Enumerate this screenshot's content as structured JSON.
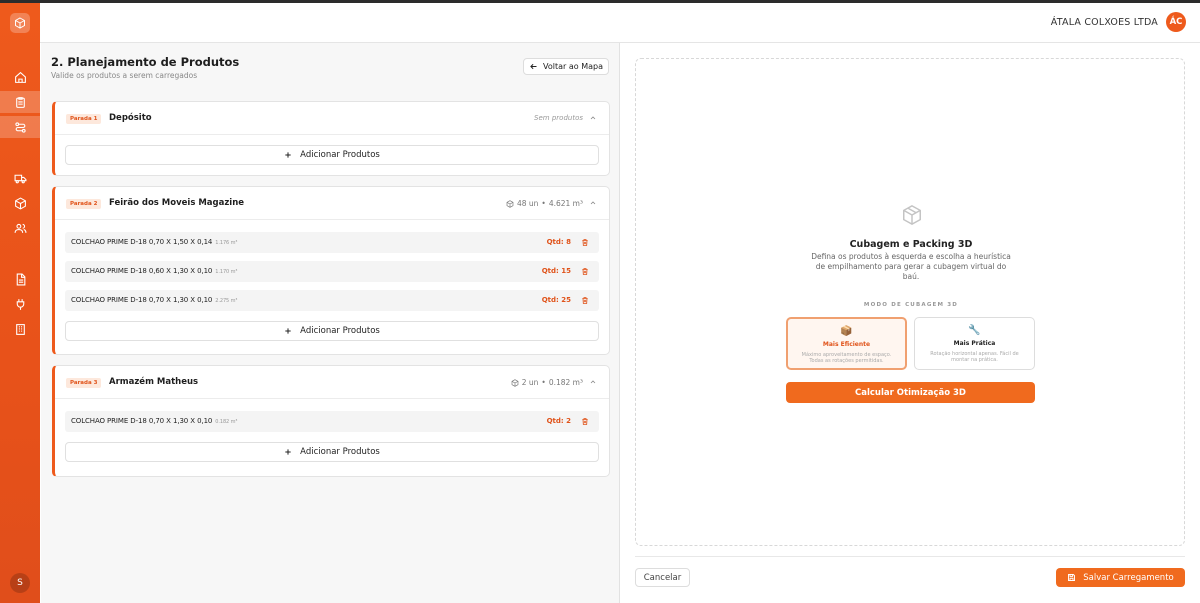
{
  "header": {
    "company": "ÁTALA COLXOES LTDA",
    "avatar_initials": "ÁC"
  },
  "sidebar": {
    "items": [
      {
        "icon": "home-icon"
      },
      {
        "icon": "clipboard-icon",
        "active": true
      },
      {
        "icon": "route-icon",
        "active": true
      },
      {
        "icon": "truck-icon"
      },
      {
        "icon": "box-icon"
      },
      {
        "icon": "users-icon"
      },
      {
        "icon": "document-icon"
      },
      {
        "icon": "plug-icon"
      },
      {
        "icon": "building-icon"
      }
    ],
    "user_initial": "S"
  },
  "planning": {
    "title": "2. Planejamento de Produtos",
    "subtitle": "Valide os produtos a serem carregados",
    "back_label": "Voltar ao Mapa",
    "add_label": "Adicionar Produtos",
    "stops": [
      {
        "badge": "Parada 1",
        "name": "Depósito",
        "meta": "Sem produtos",
        "products": []
      },
      {
        "badge": "Parada 2",
        "name": "Feirão dos Moveis Magazine",
        "units": "48 un",
        "volume": "4.621 m³",
        "products": [
          {
            "name": "COLCHAO PRIME D-18 0,70 X 1,50 X 0,14",
            "vol": "1.176 m³",
            "qty": "Qtd: 8"
          },
          {
            "name": "COLCHAO PRIME D-18 0,60 X 1,30 X 0,10",
            "vol": "1.170 m³",
            "qty": "Qtd: 15"
          },
          {
            "name": "COLCHAO PRIME D-18 0,70 X 1,30 X 0,10",
            "vol": "2.275 m³",
            "qty": "Qtd: 25"
          }
        ]
      },
      {
        "badge": "Parada 3",
        "name": "Armazém Matheus",
        "units": "2 un",
        "volume": "0.182 m³",
        "products": [
          {
            "name": "COLCHAO PRIME D-18 0,70 X 1,30 X 0,10",
            "vol": "0.182 m³",
            "qty": "Qtd: 2"
          }
        ]
      }
    ]
  },
  "cubage": {
    "title": "Cubagem e Packing 3D",
    "description": "Defina os produtos à esquerda e escolha a heurística de empilhamento para gerar a cubagem virtual do baú.",
    "mode_label": "MODO DE CUBAGEM 3D",
    "modes": [
      {
        "name": "Mais Eficiente",
        "icon": "📦",
        "desc": "Máximo aproveitamento de espaço. Todas as rotações permitidas.",
        "selected": true
      },
      {
        "name": "Mais Prática",
        "icon": "🔧",
        "desc": "Rotação horizontal apenas. Fácil de montar na prática.",
        "selected": false
      }
    ],
    "calc_label": "Calcular Otimização 3D"
  },
  "footer": {
    "cancel_label": "Cancelar",
    "save_label": "Salvar Carregamento"
  },
  "colors": {
    "accent": "#ee5a1c",
    "button": "#f06a1e"
  }
}
